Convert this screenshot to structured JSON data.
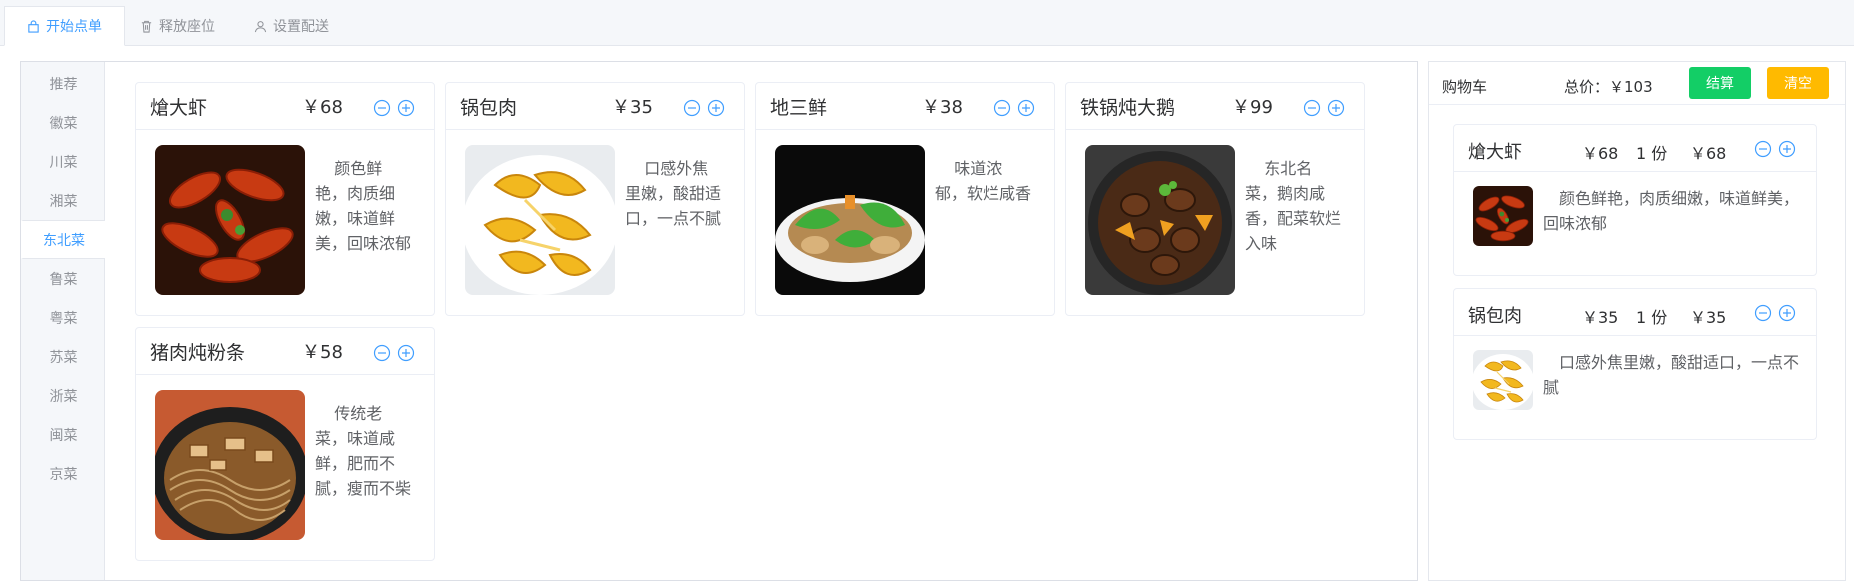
{
  "tabs": [
    {
      "label": "开始点单",
      "icon": "bag-icon"
    },
    {
      "label": "释放座位",
      "icon": "trash-icon"
    },
    {
      "label": "设置配送",
      "icon": "user-icon"
    }
  ],
  "categories": [
    "推荐",
    "徽菜",
    "川菜",
    "湘菜",
    "东北菜",
    "鲁菜",
    "粤菜",
    "苏菜",
    "浙菜",
    "闽菜",
    "京菜"
  ],
  "active_category": "东北菜",
  "dishes": [
    {
      "name": "熗大虾",
      "price": "￥68",
      "desc": "颜色鲜艳，肉质细嫩，味道鲜美，回味浓郁"
    },
    {
      "name": "锅包肉",
      "price": "￥35",
      "desc": "口感外焦里嫩，酸甜适口，一点不腻"
    },
    {
      "name": "地三鲜",
      "price": "￥38",
      "desc": "味道浓郁，软烂咸香"
    },
    {
      "name": "铁锅炖大鹅",
      "price": "￥99",
      "desc": "东北名菜，鹅肉咸香，配菜软烂入味"
    },
    {
      "name": "猪肉炖粉条",
      "price": "￥58",
      "desc": "传统老菜，味道咸鲜，肥而不腻，瘦而不柴"
    }
  ],
  "cart": {
    "title": "购物车",
    "total": "总价：￥103",
    "pay_label": "结算",
    "clear_label": "清空",
    "items": [
      {
        "name": "熗大虾",
        "price": "￥68",
        "qty": "1 份",
        "subtotal": "￥68",
        "desc": "颜色鲜艳，肉质细嫩，味道鲜美，回味浓郁"
      },
      {
        "name": "锅包肉",
        "price": "￥35",
        "qty": "1 份",
        "subtotal": "￥35",
        "desc": "口感外焦里嫩，酸甜适口，一点不腻"
      }
    ]
  },
  "colors": {
    "accent": "#409eff",
    "pay": "#13ce66",
    "clear": "#ffba00"
  }
}
